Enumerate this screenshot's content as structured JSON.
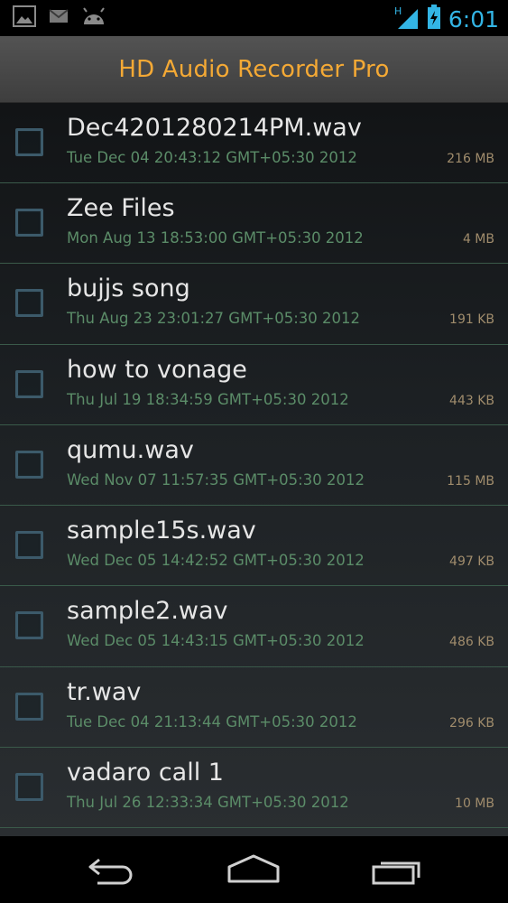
{
  "status_bar": {
    "time": "6:01",
    "signal_label": "H",
    "icons": [
      "gallery-icon",
      "mail-icon",
      "android-icon",
      "signal-icon",
      "battery-icon"
    ],
    "accent_color": "#33b5e5"
  },
  "app": {
    "title": "HD Audio Recorder Pro",
    "title_color": "#f4a935"
  },
  "files": [
    {
      "name": "Dec4201280214PM.wav",
      "date": "Tue Dec 04 20:43:12 GMT+05:30 2012",
      "size": "216 MB"
    },
    {
      "name": "Zee Files",
      "date": "Mon Aug 13 18:53:00 GMT+05:30 2012",
      "size": "4 MB"
    },
    {
      "name": "bujjs song",
      "date": "Thu Aug 23 23:01:27 GMT+05:30 2012",
      "size": "191 KB"
    },
    {
      "name": "how to vonage",
      "date": "Thu Jul 19 18:34:59 GMT+05:30 2012",
      "size": "443 KB"
    },
    {
      "name": "qumu.wav",
      "date": "Wed Nov 07 11:57:35 GMT+05:30 2012",
      "size": "115 MB"
    },
    {
      "name": "sample15s.wav",
      "date": "Wed Dec 05 14:42:52 GMT+05:30 2012",
      "size": "497 KB"
    },
    {
      "name": "sample2.wav",
      "date": "Wed Dec 05 14:43:15 GMT+05:30 2012",
      "size": "486 KB"
    },
    {
      "name": "tr.wav",
      "date": "Tue Dec 04 21:13:44 GMT+05:30 2012",
      "size": "296 KB"
    },
    {
      "name": "vadaro call 1",
      "date": "Thu Jul 26 12:33:34 GMT+05:30 2012",
      "size": "10 MB"
    }
  ],
  "nav_bar": {
    "icons": [
      "back-icon",
      "home-icon",
      "recent-apps-icon"
    ]
  }
}
